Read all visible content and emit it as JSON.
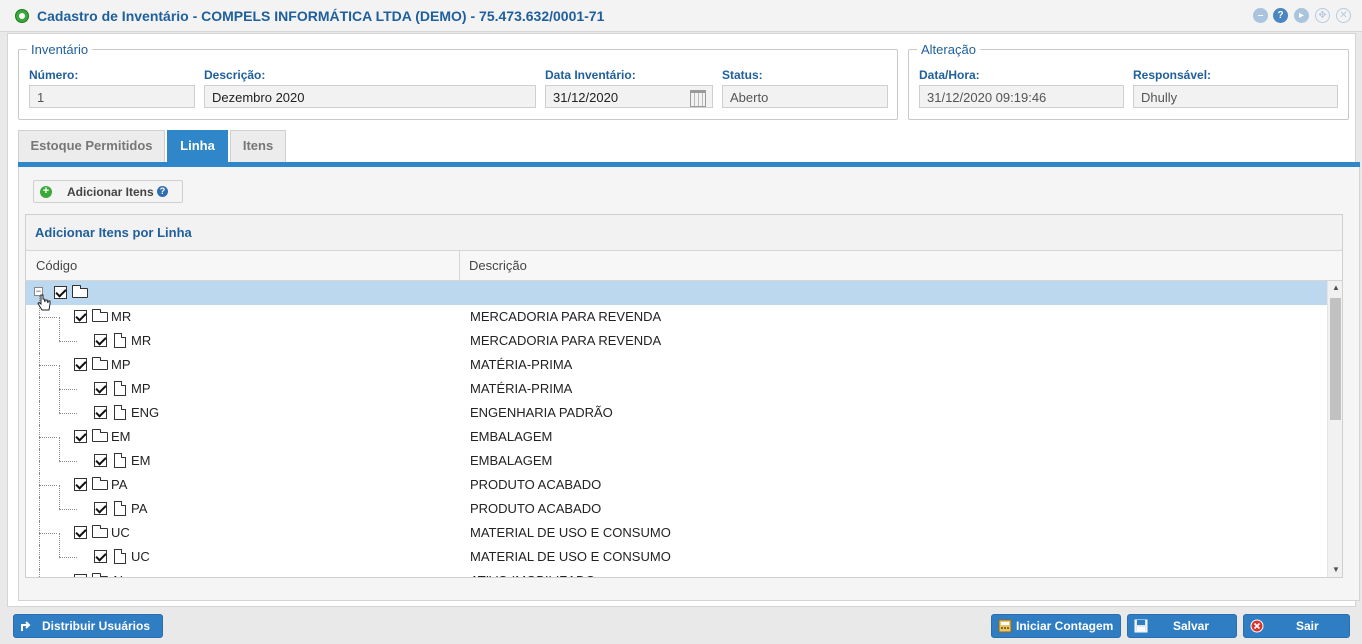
{
  "window": {
    "title": "Cadastro de Inventário - COMPELS INFORMÁTICA LTDA (DEMO) - 75.473.632/0001-71",
    "buttons": [
      "minimize-icon",
      "help-icon",
      "next-icon",
      "navigate-icon",
      "close-icon"
    ]
  },
  "inventario": {
    "legend": "Inventário",
    "numero_label": "Número:",
    "numero_value": "1",
    "descricao_label": "Descrição:",
    "descricao_value": "Dezembro 2020",
    "data_label": "Data Inventário:",
    "data_value": "31/12/2020",
    "status_label": "Status:",
    "status_value": "Aberto"
  },
  "alteracao": {
    "legend": "Alteração",
    "datahora_label": "Data/Hora:",
    "datahora_value": "31/12/2020 09:19:46",
    "responsavel_label": "Responsável:",
    "responsavel_value": "Dhully"
  },
  "tabs": [
    {
      "label": "Estoque Permitidos",
      "active": false
    },
    {
      "label": "Linha",
      "active": true
    },
    {
      "label": "Itens",
      "active": false
    }
  ],
  "panel": {
    "add_button": "Adicionar Itens",
    "add_button_help": "?",
    "grid_title": "Adicionar Itens por Linha",
    "col_codigo": "Código",
    "col_descricao": "Descrição"
  },
  "tree": [
    {
      "code": "",
      "desc": "",
      "type": "folder",
      "level": 0,
      "checked": true,
      "selected": true
    },
    {
      "code": "MR",
      "desc": "MERCADORIA PARA REVENDA",
      "type": "folder",
      "level": 1,
      "checked": true
    },
    {
      "code": "MR",
      "desc": "MERCADORIA PARA REVENDA",
      "type": "file",
      "level": 2,
      "checked": true
    },
    {
      "code": "MP",
      "desc": "MATÉRIA-PRIMA",
      "type": "folder",
      "level": 1,
      "checked": true
    },
    {
      "code": "MP",
      "desc": "MATÉRIA-PRIMA",
      "type": "file",
      "level": 2,
      "checked": true
    },
    {
      "code": "ENG",
      "desc": "ENGENHARIA PADRÃO",
      "type": "file",
      "level": 2,
      "checked": true
    },
    {
      "code": "EM",
      "desc": "EMBALAGEM",
      "type": "folder",
      "level": 1,
      "checked": true
    },
    {
      "code": "EM",
      "desc": "EMBALAGEM",
      "type": "file",
      "level": 2,
      "checked": true
    },
    {
      "code": "PA",
      "desc": "PRODUTO ACABADO",
      "type": "folder",
      "level": 1,
      "checked": true
    },
    {
      "code": "PA",
      "desc": "PRODUTO ACABADO",
      "type": "file",
      "level": 2,
      "checked": true
    },
    {
      "code": "UC",
      "desc": "MATERIAL DE USO E CONSUMO",
      "type": "folder",
      "level": 1,
      "checked": true
    },
    {
      "code": "UC",
      "desc": "MATERIAL DE USO E CONSUMO",
      "type": "file",
      "level": 2,
      "checked": true
    },
    {
      "code": "AI",
      "desc": "ATIVO IMOBILIZADO",
      "type": "folder",
      "level": 1,
      "checked": true
    }
  ],
  "footer": {
    "distribuir": "Distribuir Usuários",
    "iniciar": "Iniciar Contagem",
    "salvar": "Salvar",
    "sair": "Sair"
  },
  "colors": {
    "accent": "#2f86c8",
    "label": "#1f5f9c",
    "selected_row": "#bcd8ee"
  }
}
